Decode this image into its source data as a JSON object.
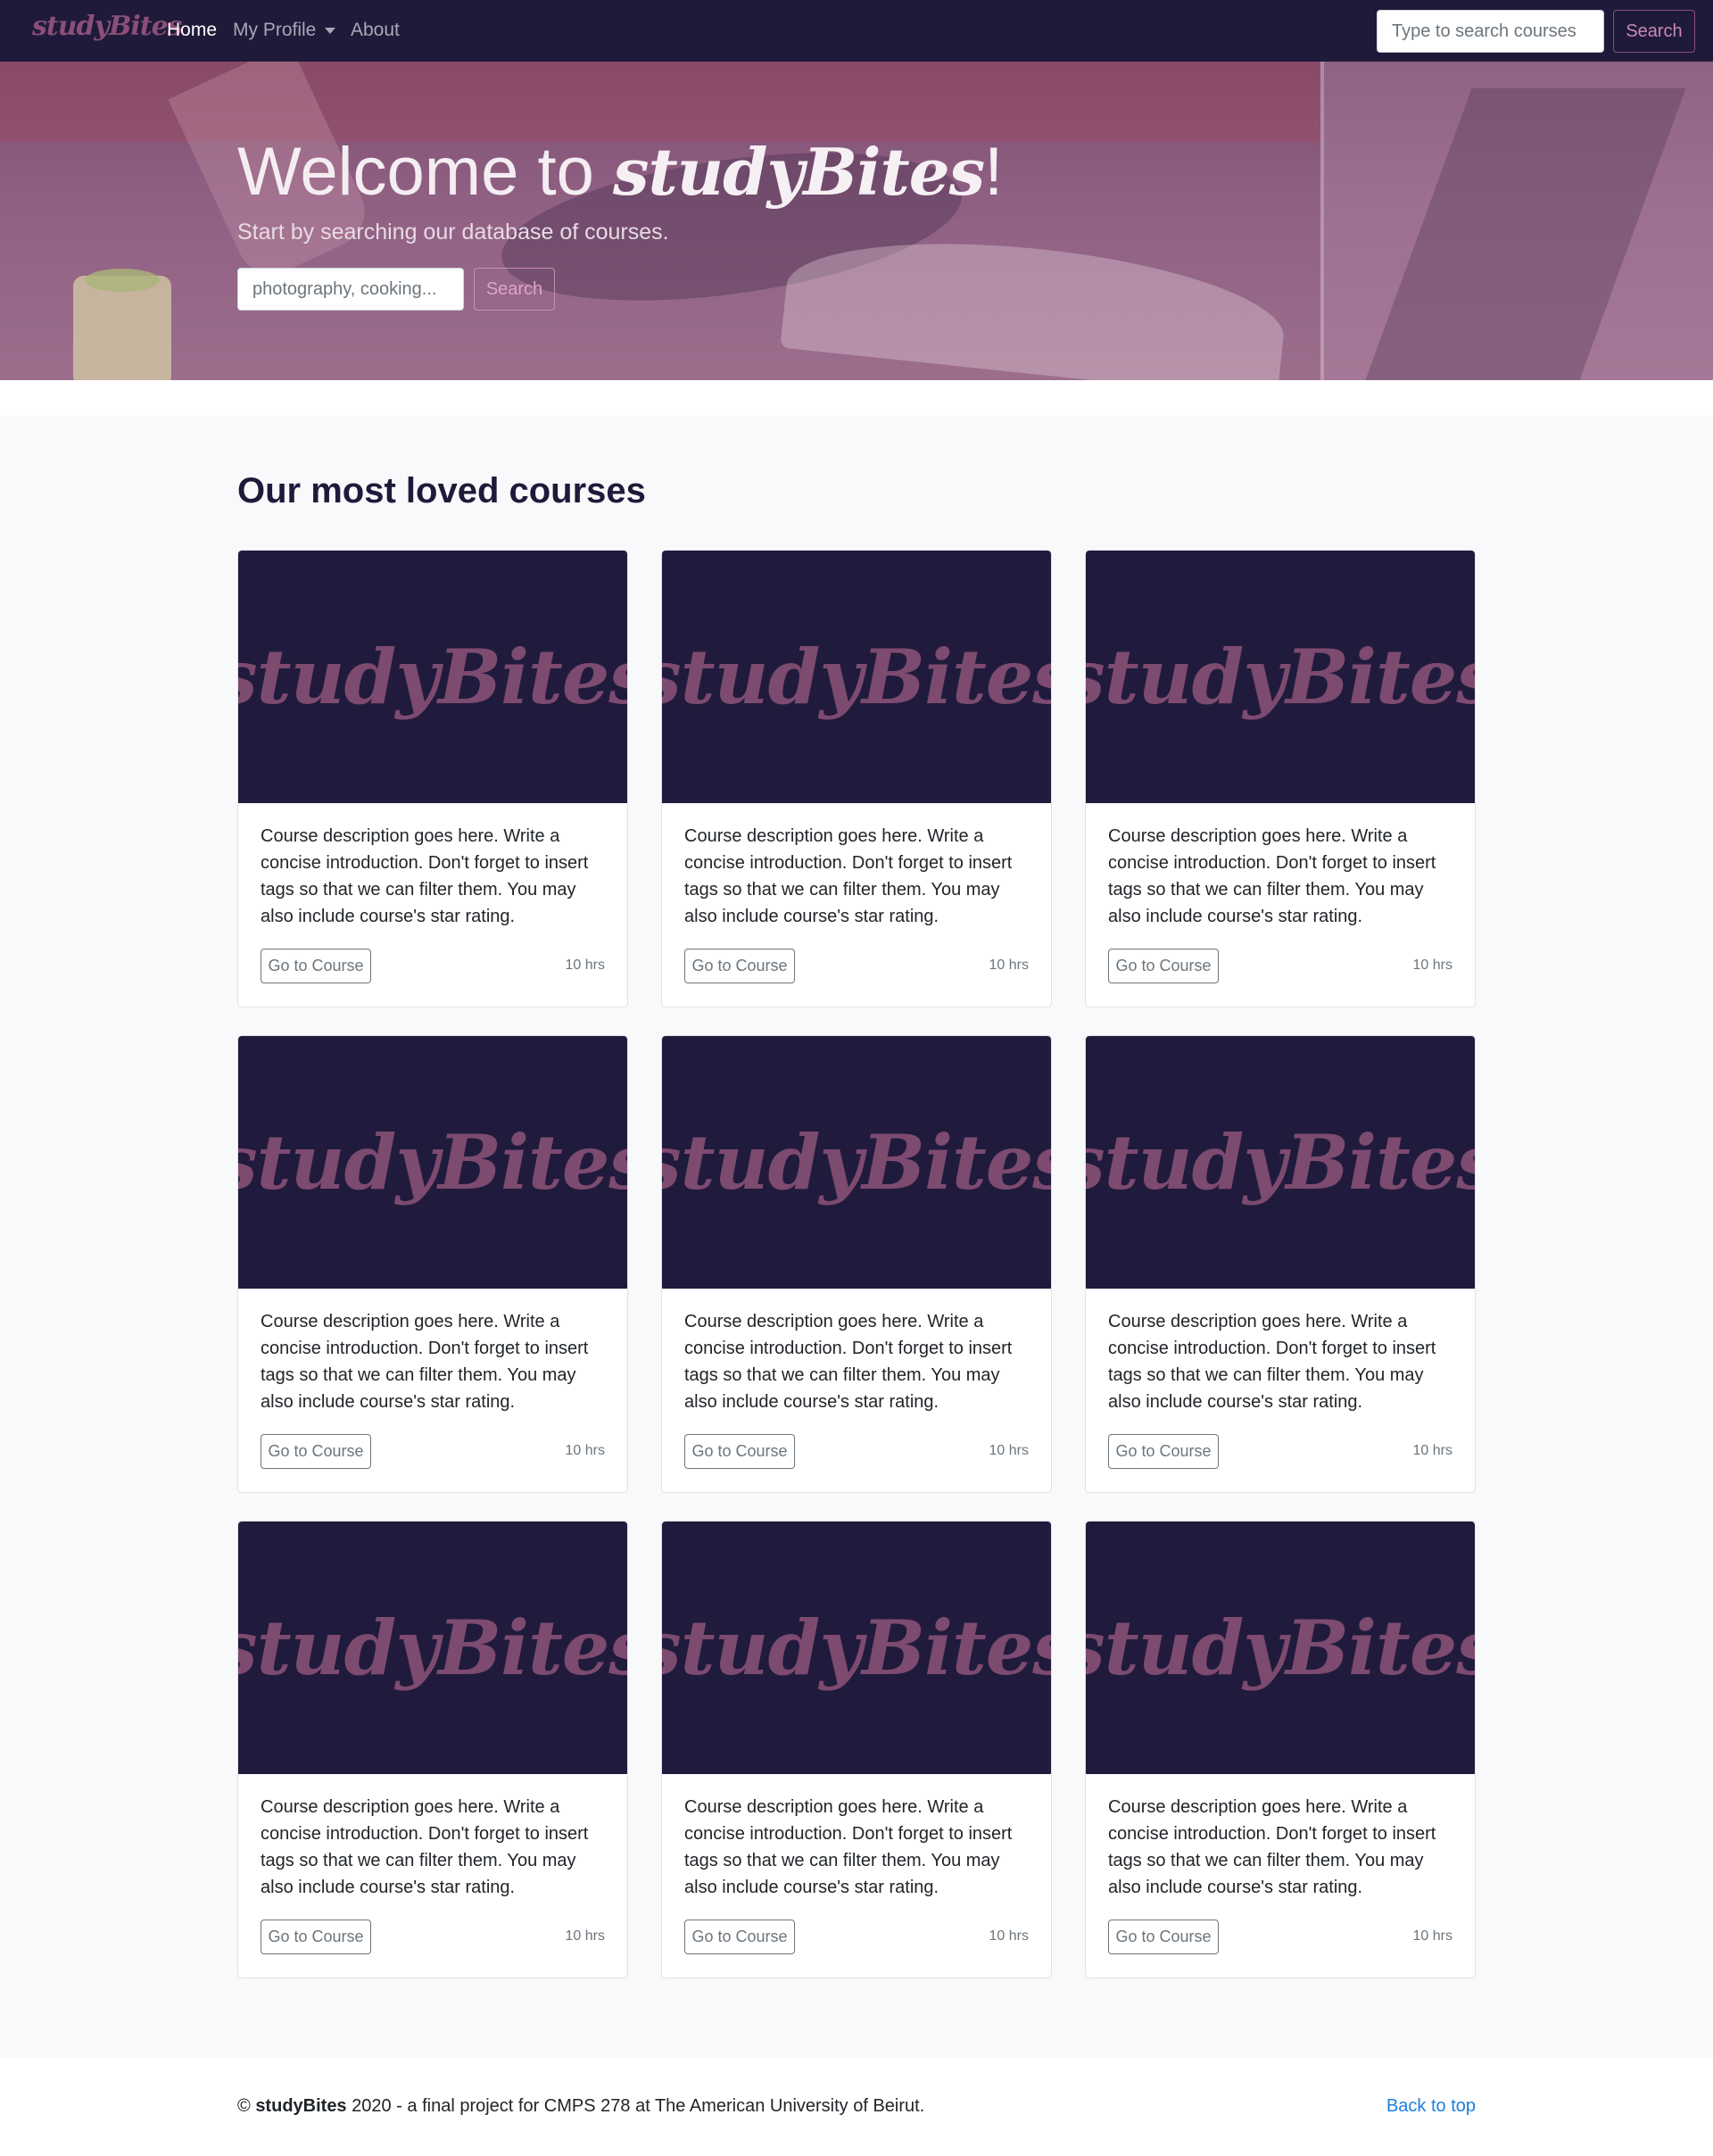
{
  "nav": {
    "brand": "studyBites",
    "items": [
      {
        "label": "Home",
        "active": true
      },
      {
        "label": "My Profile",
        "dropdown": true
      },
      {
        "label": "About"
      }
    ],
    "search": {
      "placeholder": "Type to search courses",
      "button": "Search"
    }
  },
  "hero": {
    "title_prefix": "Welcome to ",
    "title_brand": "studyBites",
    "title_suffix": "!",
    "subtitle": "Start by searching our database of courses.",
    "search": {
      "placeholder": "photography, cooking...",
      "button": "Search"
    }
  },
  "section": {
    "title": "Our most loved courses"
  },
  "courses": [
    {
      "image_text": "studyBites",
      "description": "Course description goes here. Write a concise introduction. Don't forget to insert tags so that we can filter them. You may also include course's star rating.",
      "button": "Go to Course",
      "duration": "10 hrs"
    },
    {
      "image_text": "studyBites",
      "description": "Course description goes here. Write a concise introduction. Don't forget to insert tags so that we can filter them. You may also include course's star rating.",
      "button": "Go to Course",
      "duration": "10 hrs"
    },
    {
      "image_text": "studyBites",
      "description": "Course description goes here. Write a concise introduction. Don't forget to insert tags so that we can filter them. You may also include course's star rating.",
      "button": "Go to Course",
      "duration": "10 hrs"
    },
    {
      "image_text": "studyBites",
      "description": "Course description goes here. Write a concise introduction. Don't forget to insert tags so that we can filter them. You may also include course's star rating.",
      "button": "Go to Course",
      "duration": "10 hrs"
    },
    {
      "image_text": "studyBites",
      "description": "Course description goes here. Write a concise introduction. Don't forget to insert tags so that we can filter them. You may also include course's star rating.",
      "button": "Go to Course",
      "duration": "10 hrs"
    },
    {
      "image_text": "studyBites",
      "description": "Course description goes here. Write a concise introduction. Don't forget to insert tags so that we can filter them. You may also include course's star rating.",
      "button": "Go to Course",
      "duration": "10 hrs"
    },
    {
      "image_text": "studyBites",
      "description": "Course description goes here. Write a concise introduction. Don't forget to insert tags so that we can filter them. You may also include course's star rating.",
      "button": "Go to Course",
      "duration": "10 hrs"
    },
    {
      "image_text": "studyBites",
      "description": "Course description goes here. Write a concise introduction. Don't forget to insert tags so that we can filter them. You may also include course's star rating.",
      "button": "Go to Course",
      "duration": "10 hrs"
    },
    {
      "image_text": "studyBites",
      "description": "Course description goes here. Write a concise introduction. Don't forget to insert tags so that we can filter them. You may also include course's star rating.",
      "button": "Go to Course",
      "duration": "10 hrs"
    }
  ],
  "footer": {
    "copyright": "©",
    "brand": "studyBites",
    "text": "2020 - a final project for CMPS 278 at The American University of Beirut.",
    "back_to_top": "Back to top"
  },
  "colors": {
    "navbar_bg": "#1f1a3a",
    "accent": "#8a4f78",
    "card_image_bg": "#201b3c",
    "link": "#1a7fe0"
  }
}
